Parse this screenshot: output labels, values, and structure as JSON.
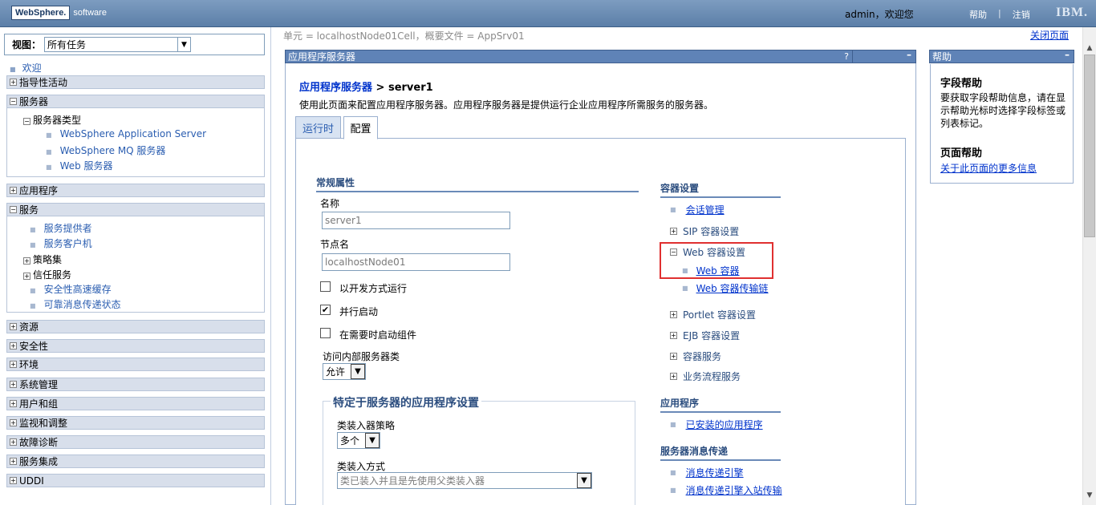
{
  "header": {
    "logo_brand": "WebSphere.",
    "logo_product": "software",
    "user_greeting": "admin，欢迎您",
    "help_link": "帮助",
    "separator": "|",
    "logout_link": "注销",
    "ibm_logo": "IBM."
  },
  "left_nav": {
    "view_label": "视图：",
    "view_value": "所有任务",
    "welcome": "欢迎",
    "sections": [
      {
        "label": "指导性活动",
        "expanded": false
      },
      {
        "label": "服务器",
        "expanded": true
      },
      {
        "label": "应用程序",
        "expanded": false
      },
      {
        "label": "服务",
        "expanded": true
      },
      {
        "label": "资源",
        "expanded": false
      },
      {
        "label": "安全性",
        "expanded": false
      },
      {
        "label": "环境",
        "expanded": false
      },
      {
        "label": "系统管理",
        "expanded": false
      },
      {
        "label": "用户和组",
        "expanded": false
      },
      {
        "label": "监视和调整",
        "expanded": false
      },
      {
        "label": "故障诊断",
        "expanded": false
      },
      {
        "label": "服务集成",
        "expanded": false
      },
      {
        "label": "UDDI",
        "expanded": false
      }
    ],
    "servers_children": {
      "server_types": "服务器类型",
      "items": [
        "WebSphere Application Server",
        "WebSphere MQ 服务器",
        "Web 服务器"
      ]
    },
    "services_children": {
      "items": [
        "服务提供者",
        "服务客户机",
        "策略集",
        "信任服务",
        "安全性高速缓存",
        "可靠消息传递状态"
      ]
    }
  },
  "main": {
    "breadcrumb": "单元 = localhostNode01Cell，概要文件 = AppSrv01",
    "close_page": "关闭页面",
    "panel_title": "应用程序服务器",
    "panel_question": "?",
    "panel_minimize": "–",
    "page_title_link": "应用程序服务器",
    "page_title_sep": " > ",
    "page_title_current": "server1",
    "description": "使用此页面来配置应用程序服务器。应用程序服务器是提供运行企业应用程序所需服务的服务器。",
    "tabs": [
      {
        "label": "运行时",
        "active": false
      },
      {
        "label": "配置",
        "active": true
      }
    ],
    "general": {
      "heading": "常规属性",
      "name_label": "名称",
      "name_value": "server1",
      "node_label": "节点名",
      "node_value": "localhostNode01",
      "dev_mode_label": "以开发方式运行",
      "dev_mode_checked": false,
      "parallel_label": "并行启动",
      "parallel_checked": true,
      "on_demand_label": "在需要时启动组件",
      "on_demand_checked": false,
      "internal_classes_label": "访问内部服务器类",
      "internal_classes_value": "允许"
    },
    "app_settings": {
      "legend": "特定于服务器的应用程序设置",
      "classloader_policy_label": "类装入器策略",
      "classloader_policy_value": "多个",
      "class_loading_label": "类装入方式",
      "class_loading_value": "类已装入并且是先使用父类装入器"
    },
    "container_settings": {
      "heading": "容器设置",
      "session_mgmt": "会话管理",
      "sip": "SIP 容器设置",
      "web_container_settings": "Web 容器设置",
      "web_container": "Web 容器",
      "web_container_chain": "Web 容器传输链",
      "portlet": "Portlet 容器设置",
      "ejb": "EJB 容器设置",
      "container_services": "容器服务",
      "business_process": "业务流程服务"
    },
    "applications": {
      "heading": "应用程序",
      "installed": "已安装的应用程序"
    },
    "messaging": {
      "heading": "服务器消息传递",
      "engines": "消息传递引擎",
      "inbound": "消息传递引擎入站传输"
    }
  },
  "help_panel": {
    "title": "帮助",
    "minimize": "–",
    "field_help_title": "字段帮助",
    "field_help_text": "要获取字段帮助信息，请在显示帮助光标时选择字段标签或列表标记。",
    "page_help_title": "页面帮助",
    "page_help_link": "关于此页面的更多信息"
  }
}
